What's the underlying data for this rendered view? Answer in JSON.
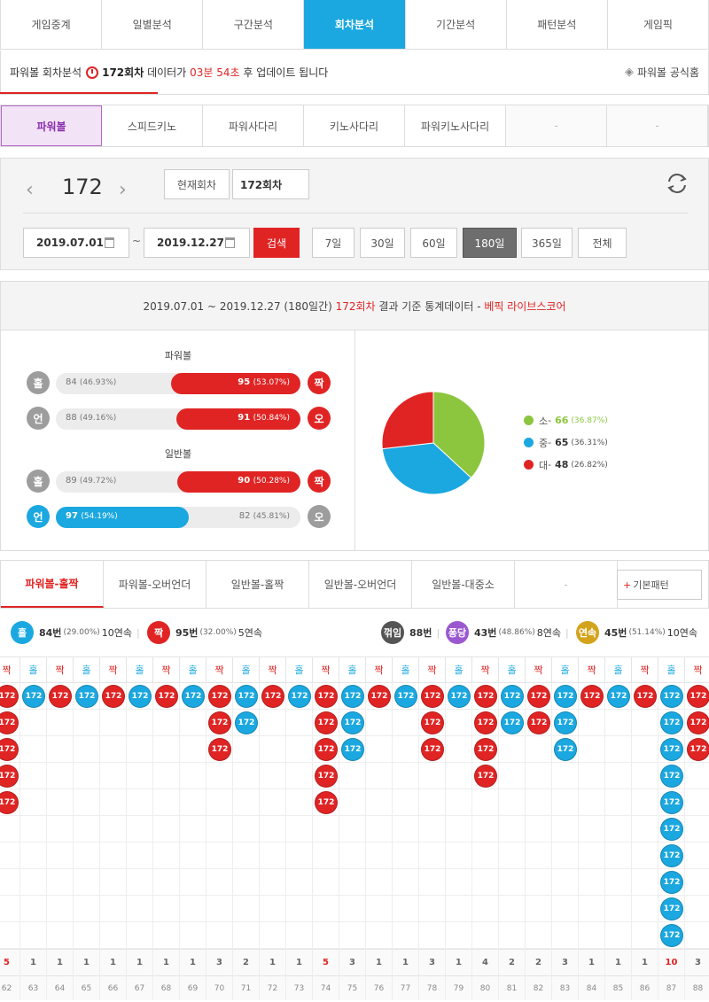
{
  "top_nav": [
    "게임중계",
    "일별분석",
    "구간분석",
    "회차분석",
    "기간분석",
    "패턴분석",
    "게임픽"
  ],
  "top_nav_active": 3,
  "info": {
    "prefix": "파워볼 회차분석",
    "round": "172회차",
    "middle": "데이터가",
    "time": "03분 54초",
    "suffix": "후 업데이트 됩니다",
    "home_link": "파워볼 공식홈"
  },
  "game_nav": [
    "파워볼",
    "스피드키노",
    "파워사다리",
    "키노사다리",
    "파워키노사다리",
    "-",
    "-"
  ],
  "game_nav_active": 0,
  "search": {
    "current_round": "172",
    "current_label": "현재회차",
    "round_value": "172회차",
    "date_from": "2019.07.01",
    "tilde": "~",
    "date_to": "2019.12.27",
    "search_label": "검색",
    "periods": [
      "7일",
      "30일",
      "60일",
      "180일",
      "365일",
      "전체"
    ],
    "period_active": 3
  },
  "stats": {
    "header_pre": "2019.07.01 ~ 2019.12.27 (180일간)",
    "header_round": "172회차",
    "header_mid": "결과 기준 통계데이터 -",
    "header_link": "베픽 라이브스코어",
    "powerball_title": "파워볼",
    "normal_title": "일반볼",
    "rows": [
      {
        "left_badge": "홀",
        "left_value": "84",
        "left_pct": "(46.93%)",
        "right_value": "95",
        "right_pct": "(53.07%)",
        "right_badge": "짝",
        "right_share": 0.5307,
        "win": "right"
      },
      {
        "left_badge": "언",
        "left_value": "88",
        "left_pct": "(49.16%)",
        "right_value": "91",
        "right_pct": "(50.84%)",
        "right_badge": "오",
        "right_share": 0.5084,
        "win": "right"
      },
      {
        "left_badge": "홀",
        "left_value": "89",
        "left_pct": "(49.72%)",
        "right_value": "90",
        "right_pct": "(50.28%)",
        "right_badge": "짝",
        "right_share": 0.5028,
        "win": "right"
      },
      {
        "left_badge": "언",
        "left_value": "97",
        "left_pct": "(54.19%)",
        "right_value": "82",
        "right_pct": "(45.81%)",
        "right_badge": "오",
        "right_share": 0.4581,
        "win": "left"
      }
    ],
    "size": [
      {
        "label": "소",
        "value": "66",
        "pct": "(36.87%)",
        "color": "#8cc63f",
        "share": 0.3687
      },
      {
        "label": "중",
        "value": "65",
        "pct": "(36.31%)",
        "color": "#1ba8e0",
        "share": 0.3631
      },
      {
        "label": "대",
        "value": "48",
        "pct": "(26.82%)",
        "color": "#e02424",
        "share": 0.2682
      }
    ]
  },
  "pattern_tabs": [
    "파워볼-홀짝",
    "파워볼-오버언더",
    "일반볼-홀짝",
    "일반볼-오버언더",
    "일반볼-대중소",
    "-"
  ],
  "pattern_tab_active": 0,
  "basic_pattern_label": "기본패턴",
  "summary": {
    "odd": {
      "badge": "홀",
      "count": "84번",
      "pct": "(29.00%)",
      "streak": "10연속"
    },
    "even": {
      "badge": "짝",
      "count": "95번",
      "pct": "(32.00%)",
      "streak": "5연속"
    },
    "broken": {
      "badge": "꺾임",
      "count": "88번"
    },
    "pong": {
      "badge": "퐁당",
      "count": "43번",
      "pct": "(48.86%)",
      "streak": "8연속"
    },
    "streak": {
      "badge": "연속",
      "count": "45번",
      "pct": "(51.14%)",
      "streak": "10연속"
    }
  },
  "pattern": {
    "ball_label": "172",
    "odd_label": "홀",
    "even_label": "짝",
    "columns": [
      {
        "type": "짝",
        "count": "5",
        "id": "62"
      },
      {
        "type": "홀",
        "count": "1",
        "id": "63"
      },
      {
        "type": "짝",
        "count": "1",
        "id": "64"
      },
      {
        "type": "홀",
        "count": "1",
        "id": "65"
      },
      {
        "type": "짝",
        "count": "1",
        "id": "66"
      },
      {
        "type": "홀",
        "count": "1",
        "id": "67"
      },
      {
        "type": "짝",
        "count": "1",
        "id": "68"
      },
      {
        "type": "홀",
        "count": "1",
        "id": "69"
      },
      {
        "type": "짝",
        "count": "3",
        "id": "70"
      },
      {
        "type": "홀",
        "count": "2",
        "id": "71"
      },
      {
        "type": "짝",
        "count": "1",
        "id": "72"
      },
      {
        "type": "홀",
        "count": "1",
        "id": "73"
      },
      {
        "type": "짝",
        "count": "5",
        "id": "74"
      },
      {
        "type": "홀",
        "count": "3",
        "id": "75"
      },
      {
        "type": "짝",
        "count": "1",
        "id": "76"
      },
      {
        "type": "홀",
        "count": "1",
        "id": "77"
      },
      {
        "type": "짝",
        "count": "3",
        "id": "78"
      },
      {
        "type": "홀",
        "count": "1",
        "id": "79"
      },
      {
        "type": "짝",
        "count": "4",
        "id": "80"
      },
      {
        "type": "홀",
        "count": "2",
        "id": "81"
      },
      {
        "type": "짝",
        "count": "2",
        "id": "82"
      },
      {
        "type": "홀",
        "count": "3",
        "id": "83"
      },
      {
        "type": "짝",
        "count": "1",
        "id": "84"
      },
      {
        "type": "홀",
        "count": "1",
        "id": "85"
      },
      {
        "type": "짝",
        "count": "1",
        "id": "86"
      },
      {
        "type": "홀",
        "count": "10",
        "id": "87"
      },
      {
        "type": "짝",
        "count": "3",
        "id": "88"
      }
    ]
  },
  "colors": {
    "red": "#e02424",
    "blue": "#1ba8e0",
    "gray": "#9d9d9d",
    "purple": "#9b59d0",
    "gold": "#d3a31c",
    "green": "#8cc63f"
  }
}
